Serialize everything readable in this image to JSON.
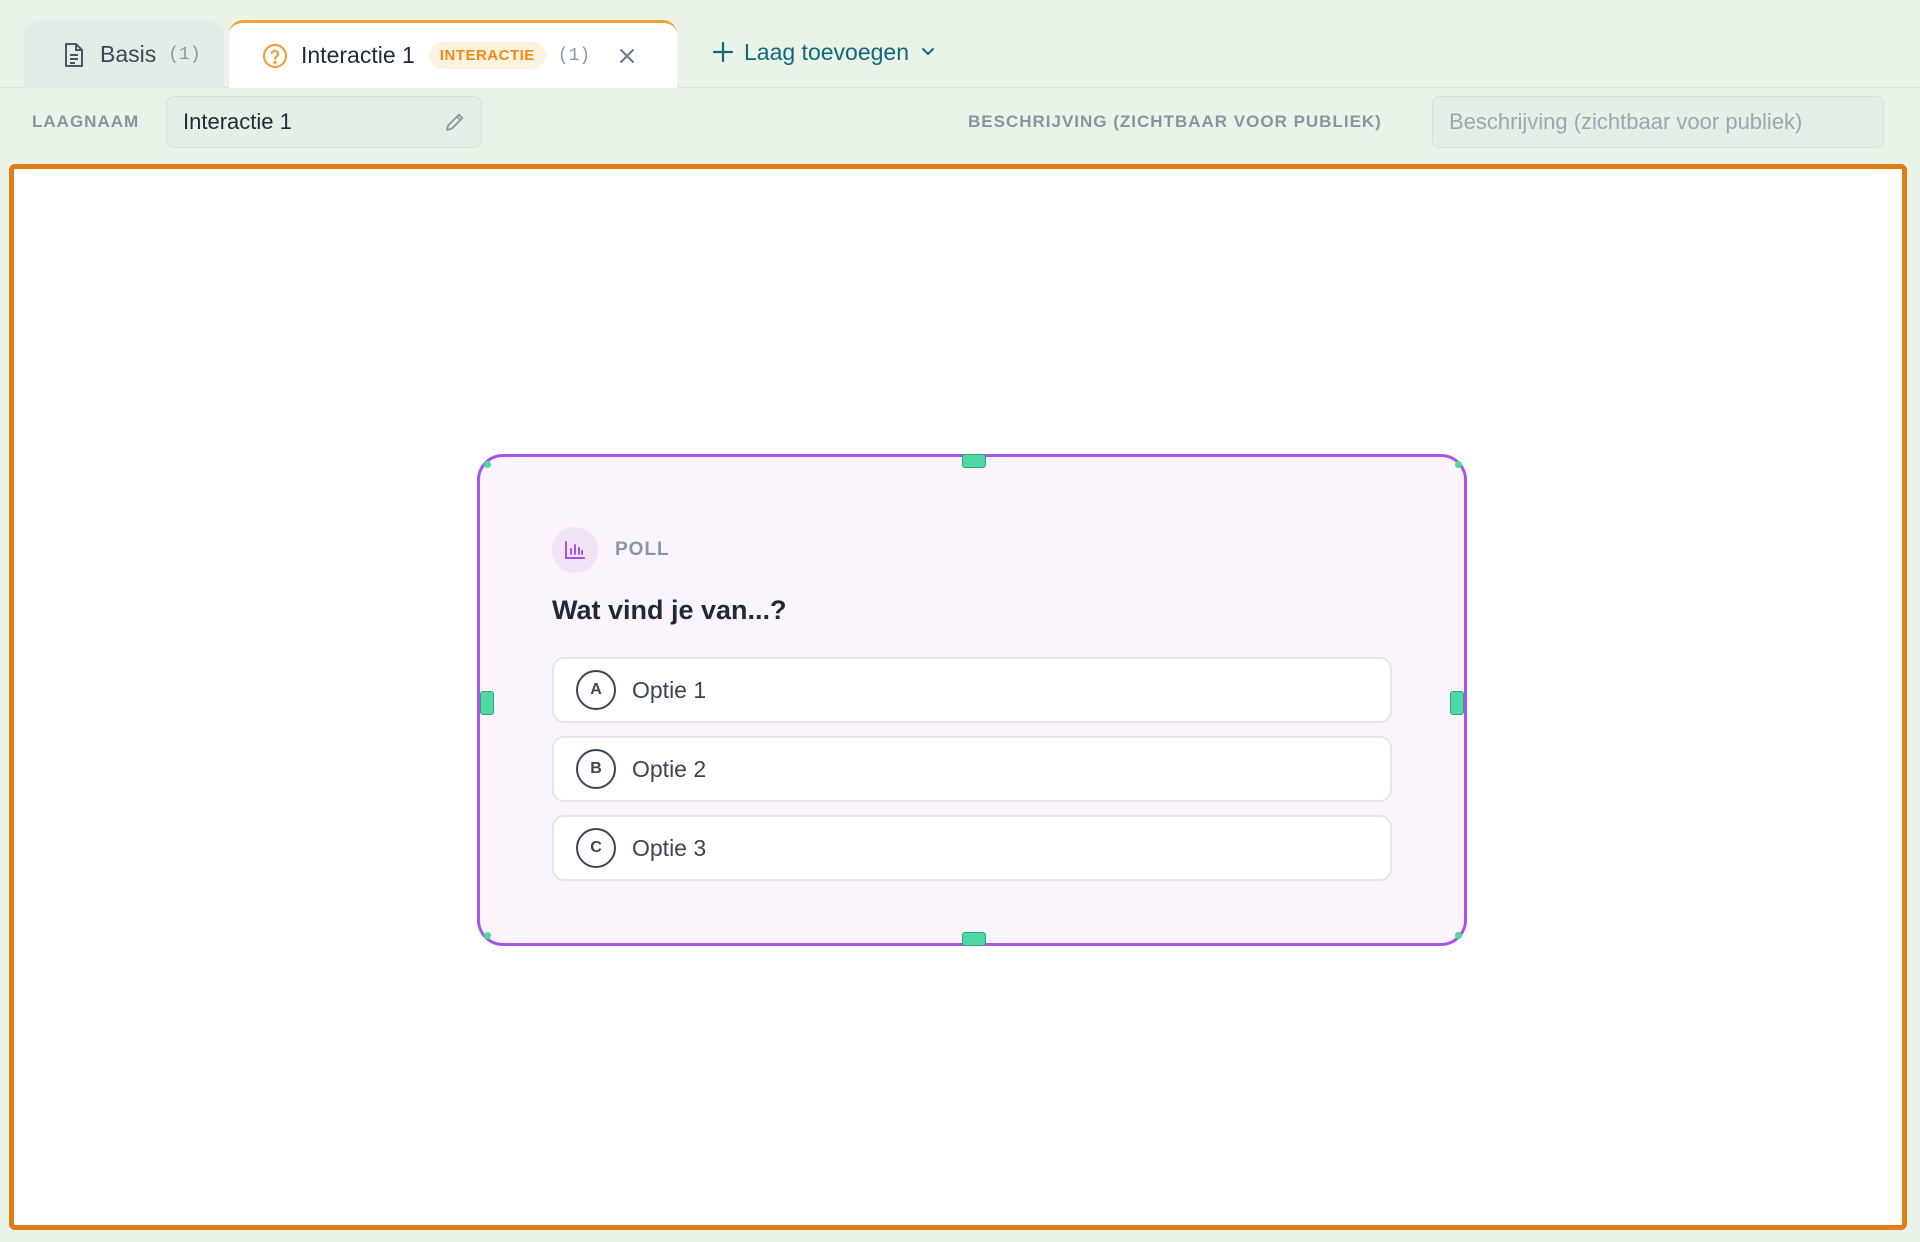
{
  "tabs": [
    {
      "label": "Basis",
      "count": "(1)",
      "icon": "document-icon"
    },
    {
      "label": "Interactie 1",
      "badge": "INTERACTIE",
      "count": "(1)",
      "icon": "question-circle-icon"
    }
  ],
  "add_layer": {
    "label": "Laag toevoegen"
  },
  "fields": {
    "name_label": "LAAGNAAM",
    "name_value": "Interactie 1",
    "description_label": "BESCHRIJVING (ZICHTBAAR VOOR PUBLIEK)",
    "description_placeholder": "Beschrijving (zichtbaar voor publiek)"
  },
  "poll": {
    "type_label": "POLL",
    "question": "Wat vind je van...?",
    "options": [
      {
        "letter": "A",
        "text": "Optie 1"
      },
      {
        "letter": "B",
        "text": "Optie 2"
      },
      {
        "letter": "C",
        "text": "Optie 3"
      }
    ]
  },
  "colors": {
    "background": "#e9f3e7",
    "canvas_border": "#e07d13",
    "card_border": "#a555e8",
    "handle": "#4ed8a3",
    "badge_text": "#f08a12",
    "link": "#12677e"
  }
}
